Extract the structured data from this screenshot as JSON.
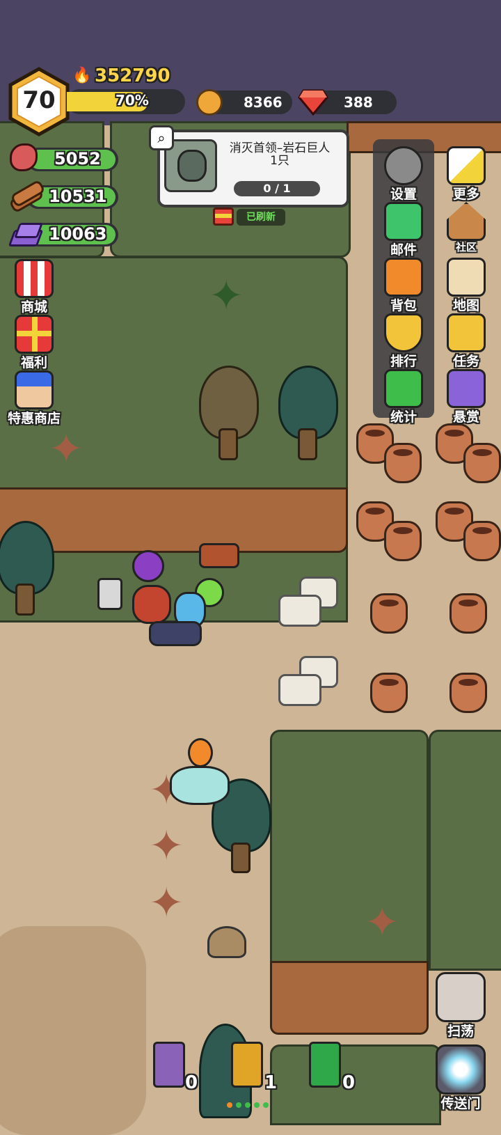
{
  "player": {
    "level": "70",
    "power": "352790",
    "exp_percent_label": "70%",
    "exp_fraction": 0.7
  },
  "currency": {
    "gold": "8366",
    "gems": "388"
  },
  "resources": {
    "meat": "5052",
    "wood": "10531",
    "ore": "10063"
  },
  "quest": {
    "title_line1": "消灭首领–岩石巨人",
    "title_line2": "1只",
    "progress": "0 / 1",
    "refresh_label": "已刷新"
  },
  "left_menu": [
    {
      "label": "商城",
      "icon": "shop-icon"
    },
    {
      "label": "福利",
      "icon": "gift-icon"
    },
    {
      "label": "特惠商店",
      "icon": "special-shop-icon"
    }
  ],
  "right_menu": [
    {
      "label": "设置",
      "icon": "gear-icon"
    },
    {
      "label": "更多",
      "icon": "more-icon"
    },
    {
      "label": "邮件",
      "icon": "mail-icon"
    },
    {
      "label": "社区",
      "icon": "house-icon"
    },
    {
      "label": "背包",
      "icon": "backpack-icon"
    },
    {
      "label": "地图",
      "icon": "map-icon"
    },
    {
      "label": "排行",
      "icon": "trophy-icon"
    },
    {
      "label": "任务",
      "icon": "quest-scroll-icon"
    },
    {
      "label": "统计",
      "icon": "stats-book-icon"
    },
    {
      "label": "悬赏",
      "icon": "bounty-icon"
    }
  ],
  "bottom": {
    "books": [
      {
        "count": "0",
        "color": "#8a63b8",
        "icon": "lightning-book-icon"
      },
      {
        "count": "1",
        "color": "#e0a526",
        "icon": "fire-book-icon"
      },
      {
        "count": "0",
        "color": "#2fa84a",
        "icon": "heal-book-icon"
      }
    ],
    "sweep_label": "扫荡",
    "portal_label": "传送门"
  },
  "colors": {
    "exp_bar": "#f2d43a",
    "gold_coin": "#f0a73a",
    "gem": "#e8443a",
    "grass": "#5b6f47",
    "sand": "#cdb595"
  }
}
